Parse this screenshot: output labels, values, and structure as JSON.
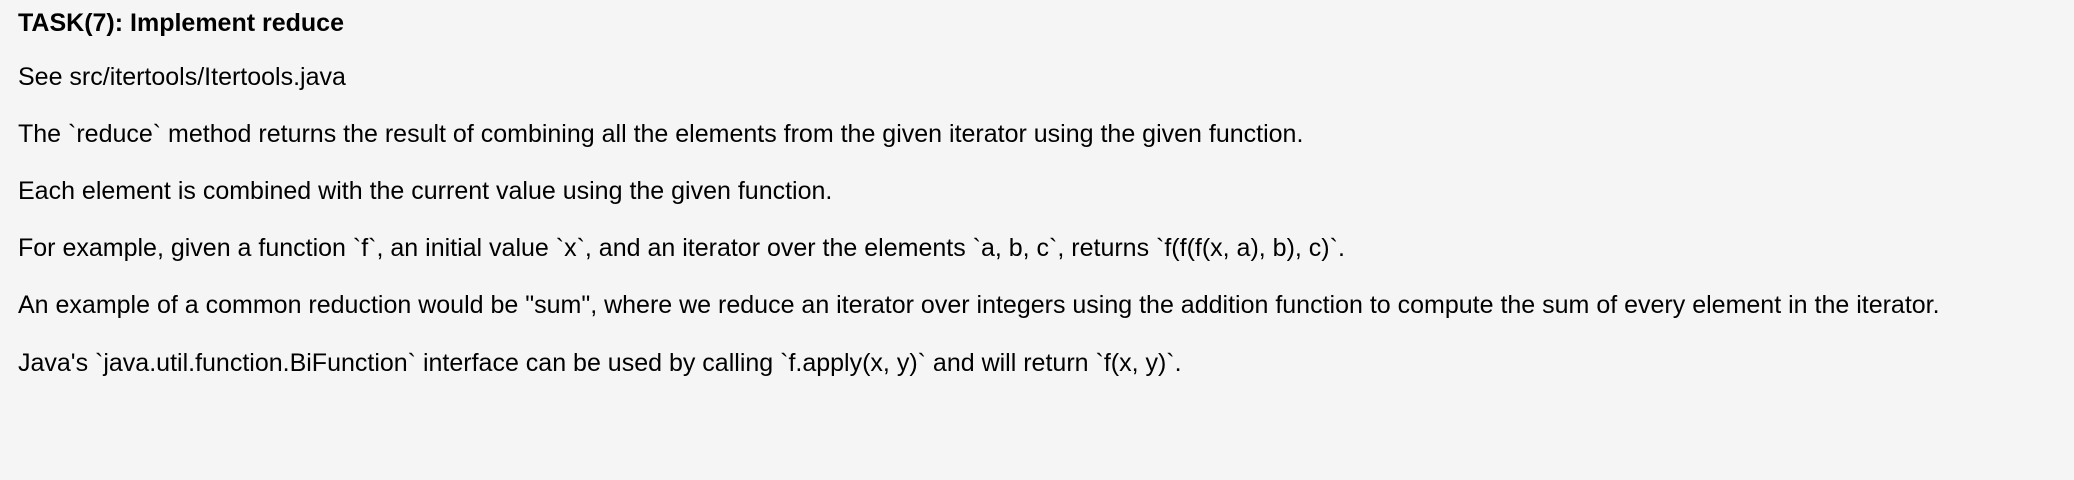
{
  "task": {
    "title": "TASK(7): Implement reduce",
    "paragraphs": [
      "See src/itertools/Itertools.java",
      "The `reduce` method returns the result of combining all the elements from the given iterator using the given function.",
      "Each element is combined with the current value using the given function.",
      "For example, given a function `f`, an initial value `x`, and an iterator over the elements `a, b, c`, returns `f(f(f(x, a), b), c)`.",
      "An example of a common reduction would be \"sum\", where we reduce an iterator over integers using the addition function to compute the sum of every element in the iterator.",
      "Java's `java.util.function.BiFunction` interface can be used by calling `f.apply(x, y)` and will return `f(x, y)`."
    ]
  }
}
